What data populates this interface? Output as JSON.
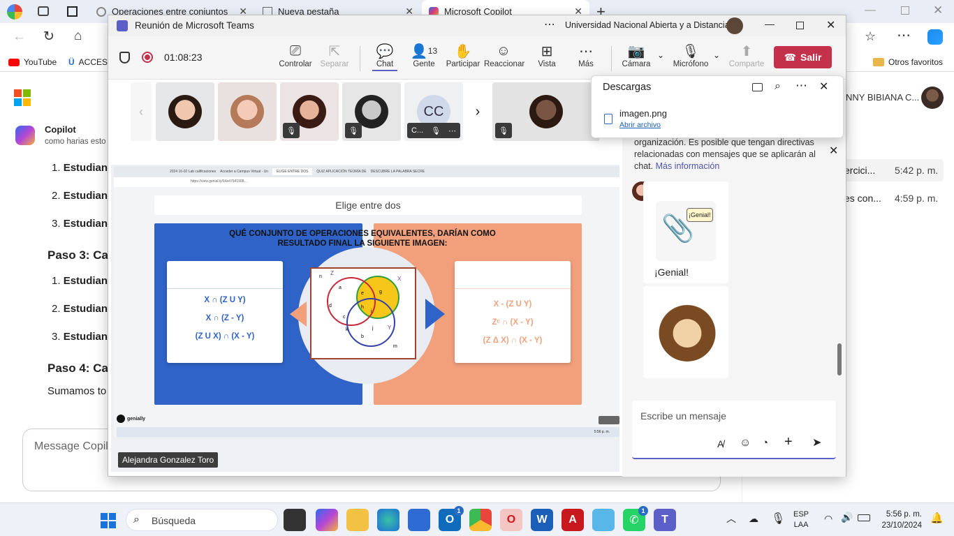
{
  "browser": {
    "tabs": [
      {
        "label": "Operaciones entre conjuntos"
      },
      {
        "label": "Nueva pestaña"
      },
      {
        "label": "Microsoft Copilot"
      }
    ],
    "favorites": [
      "YouTube",
      "ACCESI",
      "Otros favoritos"
    ]
  },
  "copilot": {
    "title": "Copilot",
    "subtitle": "como harias esto",
    "lines": [
      "Estudian",
      "Estudian",
      "Estudian",
      "Paso 3: Ca",
      "Estudian",
      "Estudian",
      "Estudian",
      "Paso 4: Ca",
      "Sumamos to"
    ],
    "message_placeholder": "Message Copilo",
    "history": [
      {
        "title": "ercici...",
        "time": "5:42 p. m."
      },
      {
        "title": "es con...",
        "time": "4:59 p. m."
      }
    ],
    "user_name": "NNY BIBIANA C..."
  },
  "teams": {
    "window_title": "Reunión de Microsoft Teams",
    "org": "Universidad Nacional Abierta y a Distancia",
    "timer": "01:08:23",
    "toolbar": {
      "controlar": "Controlar",
      "separar": "Separar",
      "chat": "Chat",
      "gente": "Gente",
      "gente_count": "13",
      "participar": "Participar",
      "reaccionar": "Reaccionar",
      "vista": "Vista",
      "mas": "Más",
      "camara": "Cámara",
      "microfono": "Micrófono",
      "comparte": "Comparte",
      "salir": "Salir"
    },
    "cc_initials": "CC",
    "cc_label": "C...",
    "presenter": "Alejandra Gonzalez Toro",
    "chat": {
      "notice": "organización. Es posible que tengan directivas relacionadas con mensajes que se aplicarán al chat.",
      "notice_link": "Más información",
      "genial_bubble": "¡Genial!",
      "genial_text": "¡Genial!",
      "input_placeholder": "Escribe un mensaje"
    }
  },
  "downloads": {
    "title": "Descargas",
    "file": "imagen.png",
    "action": "Abrir archivo"
  },
  "genially": {
    "inner_tabs": [
      "2024 16-02 Lab calificaciones",
      "Acceder a Campus Virtual - Un",
      "ELIGE ENTRE DOS",
      "QUIZ APLICACIÓN TEORÍA DE",
      "DESCUBRE LA PALABRA SECRE"
    ],
    "url": "https://view.genial.ly/64a47941908...",
    "title": "Elige entre dos",
    "question": "QUÉ CONJUNTO DE OPERACIONES EQUIVALENTES, DARÍAN COMO RESULTADO FINAL LA SIGUIENTE IMAGEN:",
    "left_options": [
      "X ∩ (Z U Y)",
      "X ∩ (Z - Y)",
      "(Z U X) ∩ (X - Y)"
    ],
    "right_options": [
      "X - (Z U Y)",
      "Zᶜ ∩ (X - Y)",
      "(Z Δ X) ∩ (X - Y)"
    ],
    "venn_labels": [
      "n",
      "Z",
      "X",
      "U",
      "a",
      "e",
      "g",
      "d",
      "h",
      "i",
      "c",
      "k",
      "j",
      "Y",
      "b",
      "m"
    ],
    "brand": "genially",
    "inner_clock": "5:56 p. m."
  },
  "taskbar": {
    "search": "Búsqueda",
    "lang1": "ESP",
    "lang2": "LAA",
    "time": "5:56 p. m.",
    "date": "23/10/2024",
    "outlook_badge": "1",
    "whatsapp_badge": "1"
  },
  "colors": {
    "teams_purple": "#5b5fc7",
    "leave_red": "#c4314b",
    "genial_blue": "#2f63c8",
    "genial_orange": "#f2a07c"
  }
}
